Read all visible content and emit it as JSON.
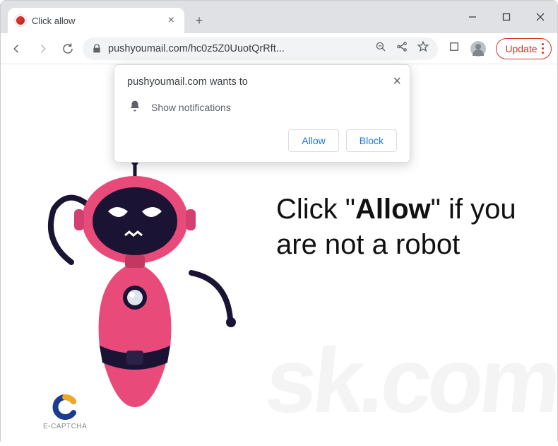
{
  "window": {
    "tab_title": "Click allow",
    "close_tab_glyph": "×",
    "new_tab_glyph": "+"
  },
  "toolbar": {
    "url": "pushyoumail.com/hc0z5Z0UuotQrRft...",
    "update_label": "Update"
  },
  "permission": {
    "title": "pushyoumail.com wants to",
    "line": "Show notifications",
    "allow_label": "Allow",
    "block_label": "Block",
    "close_glyph": "×"
  },
  "page": {
    "message_pre": "Click \"",
    "message_bold": "Allow",
    "message_post": "\" if you are not a robot",
    "captcha_label": "E-CAPTCHA",
    "watermark": "sk.com"
  }
}
